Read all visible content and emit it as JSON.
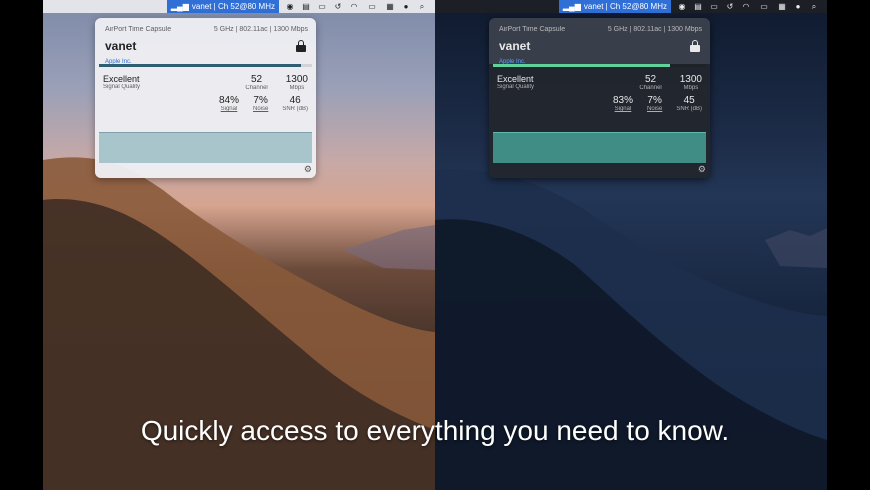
{
  "menubar": {
    "wifi_status": "vanet | Ch 52@80 MHz",
    "icons": [
      "wifi-bars-icon",
      "record-icon",
      "clipboard-icon",
      "airplay-icon",
      "time-machine-icon",
      "wifi-icon",
      "battery-icon",
      "flag-icon",
      "user-icon",
      "search-icon"
    ]
  },
  "light": {
    "device": "AirPort Time Capsule",
    "radio": "5 GHz | 802.11ac | 1300 Mbps",
    "ssid": "vanet",
    "vendor": "Apple Inc.",
    "signal_fill": 0.95,
    "quality": "Excellent",
    "quality_label": "Signal Quality",
    "channel": "52",
    "channel_label": "Channel",
    "rate": "1300",
    "rate_label": "Mbps",
    "signal": "84%",
    "signal_label": "Signal",
    "noise": "7%",
    "noise_label": "Noise",
    "snr": "46",
    "snr_label": "SNR (dB)"
  },
  "dark": {
    "device": "AirPort Time Capsule",
    "radio": "5 GHz | 802.11ac | 1300 Mbps",
    "ssid": "vanet",
    "vendor": "Apple Inc.",
    "signal_fill": 0.83,
    "quality": "Excellent",
    "quality_label": "Signal Quality",
    "channel": "52",
    "channel_label": "Channel",
    "rate": "1300",
    "rate_label": "Mbps",
    "signal": "83%",
    "signal_label": "Signal",
    "noise": "7%",
    "noise_label": "Noise",
    "snr": "45",
    "snr_label": "SNR (dB)"
  },
  "caption": "Quickly access to everything you need to know.",
  "colors": {
    "accent": "#2f6fd6",
    "light_graph": "#a9c5cc",
    "dark_graph": "#3f8d85",
    "dark_bar": "#5fd39a"
  }
}
